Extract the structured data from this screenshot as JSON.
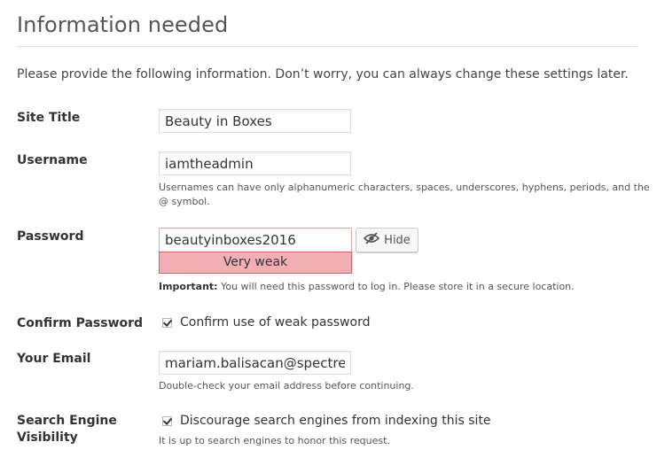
{
  "page_title": "Information needed",
  "intro": "Please provide the following information. Don’t worry, you can always change these settings later.",
  "site_title": {
    "label": "Site Title",
    "value": "Beauty in Boxes"
  },
  "username": {
    "label": "Username",
    "value": "iamtheadmin",
    "hint_line1": "Usernames can have only alphanumeric characters, spaces, underscores, hyphens, periods, and the",
    "hint_line2": "@ symbol."
  },
  "password": {
    "label": "Password",
    "value": "beautyinboxes2016",
    "strength": "Very weak",
    "hide_label": "Hide",
    "hint_strong": "Important:",
    "hint": " You will need this password to log in. Please store it in a secure location."
  },
  "confirm_password": {
    "label": "Confirm Password",
    "checkbox_label": "Confirm use of weak password",
    "checked": true
  },
  "email": {
    "label": "Your Email",
    "value": "mariam.balisacan@spectres.s",
    "hint": "Double-check your email address before continuing."
  },
  "search_engine": {
    "label_line1": "Search Engine",
    "label_line2": "Visibility",
    "checkbox_label": "Discourage search engines from indexing this site",
    "checked": true,
    "hint": "It is up to search engines to honor this request."
  },
  "icons": {
    "hide_button": "eye-slash-icon",
    "checkbox": "checkmark-icon"
  },
  "colors": {
    "strength_bg": "#f1aeb5",
    "strength_border": "#e35b5b"
  }
}
